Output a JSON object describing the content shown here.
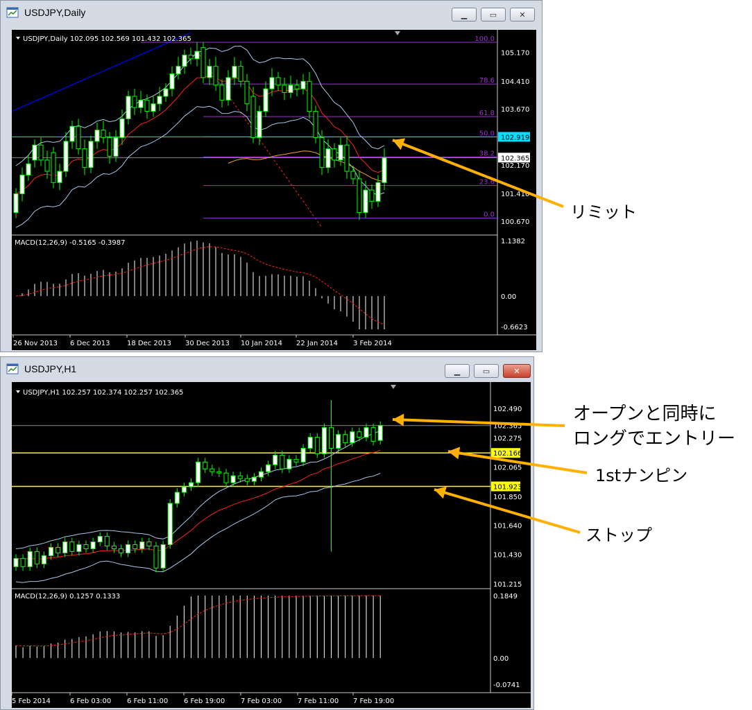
{
  "window_daily": {
    "title": "USDJPY,Daily",
    "header": "USDJPY,Daily  102.095 102.569 101.432 102.365",
    "price_labels": [
      "105.170",
      "104.410",
      "103.670",
      "102.919",
      "102.365",
      "102.170",
      "101.410",
      "100.670"
    ],
    "fib_labels": [
      "100.0",
      "78.6",
      "61.8",
      "50.0",
      "38.2",
      "23.6",
      "0.0"
    ],
    "macd_header": "MACD(12,26,9) -0.5165 -0.3987",
    "macd_labels": [
      "1.1382",
      "0.00",
      "-0.6623"
    ],
    "date_labels": [
      "26 Nov 2013",
      "6 Dec 2013",
      "18 Dec 2013",
      "30 Dec 2013",
      "10 Jan 2014",
      "22 Jan 2014",
      "3 Feb 2014"
    ]
  },
  "window_h1": {
    "title": "USDJPY,H1",
    "header": "USDJPY,H1  102.257 102.374 102.257 102.365",
    "price_labels": [
      "102.490",
      "102.365",
      "102.275",
      "102.166",
      "102.065",
      "101.923",
      "101.850",
      "101.640",
      "101.430",
      "101.215"
    ],
    "macd_header": "MACD(12,26,9) 0.1257 0.1333",
    "macd_labels": [
      "0.1849",
      "0.00",
      "-0.0741"
    ],
    "date_labels": [
      "5 Feb 2014",
      "6 Feb 03:00",
      "6 Feb 11:00",
      "6 Feb 19:00",
      "7 Feb 03:00",
      "7 Feb 11:00",
      "7 Feb 19:00"
    ]
  },
  "annotations": {
    "limit": "リミット",
    "open_entry_line1": "オープンと同時に",
    "open_entry_line2": "ロングでエントリー",
    "nanpin": "1stナンピン",
    "stop": "ストップ"
  },
  "colors": {
    "chart_bg": "#000000",
    "bull_candle": "#ffffff",
    "bear_candle": "#000000",
    "candle_wick": "#00ff00",
    "bollinger": "#a8c8e8",
    "ma_red": "#ff2020",
    "ma_orange": "#ffa020",
    "fib": "#9933cc",
    "trend_blue": "#0000ff",
    "level_cyan": "#00e0ff",
    "level_yellow": "#ffff00",
    "arrow": "#ffb000"
  },
  "chart_data": [
    {
      "type": "candlestick",
      "title": "USDJPY,Daily",
      "ylim": [
        100.3,
        105.7
      ],
      "fib_levels": {
        "100.0": 105.44,
        "78.6": 104.33,
        "61.8": 103.46,
        "50.0": 102.92,
        "38.2": 102.38,
        "23.6": 101.62,
        "0.0": 100.75
      },
      "limit_level": 102.919,
      "current_price": 102.365,
      "candles": [
        {
          "o": 100.9,
          "c": 101.4
        },
        {
          "o": 101.4,
          "c": 101.9
        },
        {
          "o": 101.9,
          "c": 102.2
        },
        {
          "o": 102.3,
          "c": 102.7
        },
        {
          "o": 102.7,
          "c": 102.3
        },
        {
          "o": 102.3,
          "c": 102.0
        },
        {
          "o": 102.5,
          "c": 101.7
        },
        {
          "o": 101.7,
          "c": 102.0
        },
        {
          "o": 102.0,
          "c": 102.8
        },
        {
          "o": 102.8,
          "c": 103.2
        },
        {
          "o": 103.2,
          "c": 102.6
        },
        {
          "o": 102.6,
          "c": 102.1
        },
        {
          "o": 102.1,
          "c": 102.8
        },
        {
          "o": 102.8,
          "c": 103.1
        },
        {
          "o": 103.1,
          "c": 102.9
        },
        {
          "o": 102.9,
          "c": 102.4
        },
        {
          "o": 102.4,
          "c": 102.9
        },
        {
          "o": 102.9,
          "c": 103.4
        },
        {
          "o": 103.4,
          "c": 104.0
        },
        {
          "o": 104.0,
          "c": 103.7
        },
        {
          "o": 103.7,
          "c": 103.9
        },
        {
          "o": 103.9,
          "c": 103.6
        },
        {
          "o": 103.6,
          "c": 103.8
        },
        {
          "o": 103.8,
          "c": 104.0
        },
        {
          "o": 104.0,
          "c": 104.2
        },
        {
          "o": 104.2,
          "c": 104.6
        },
        {
          "o": 104.6,
          "c": 104.8
        },
        {
          "o": 104.8,
          "c": 105.1
        },
        {
          "o": 105.1,
          "c": 105.0
        },
        {
          "o": 105.0,
          "c": 105.2
        },
        {
          "o": 105.3,
          "c": 104.5
        },
        {
          "o": 104.5,
          "c": 104.8
        },
        {
          "o": 104.8,
          "c": 104.3
        },
        {
          "o": 104.3,
          "c": 103.9
        },
        {
          "o": 103.9,
          "c": 104.5
        },
        {
          "o": 104.5,
          "c": 104.8
        },
        {
          "o": 104.8,
          "c": 104.4
        },
        {
          "o": 104.4,
          "c": 103.8
        },
        {
          "o": 104.0,
          "c": 102.9
        },
        {
          "o": 102.9,
          "c": 103.6
        },
        {
          "o": 103.6,
          "c": 104.2
        },
        {
          "o": 104.2,
          "c": 104.5
        },
        {
          "o": 104.5,
          "c": 104.3
        },
        {
          "o": 104.3,
          "c": 104.1
        },
        {
          "o": 104.1,
          "c": 104.3
        },
        {
          "o": 104.3,
          "c": 104.2
        },
        {
          "o": 104.2,
          "c": 104.4
        },
        {
          "o": 104.4,
          "c": 103.6
        },
        {
          "o": 103.6,
          "c": 102.9
        },
        {
          "o": 102.9,
          "c": 102.1
        },
        {
          "o": 102.1,
          "c": 102.6
        },
        {
          "o": 102.6,
          "c": 102.3
        },
        {
          "o": 102.3,
          "c": 102.7
        },
        {
          "o": 102.7,
          "c": 102.0
        },
        {
          "o": 102.0,
          "c": 101.8
        },
        {
          "o": 101.8,
          "c": 100.9
        },
        {
          "o": 100.9,
          "c": 101.5
        },
        {
          "o": 101.5,
          "c": 101.2
        },
        {
          "o": 101.2,
          "c": 101.7
        },
        {
          "o": 101.7,
          "c": 102.365
        }
      ]
    },
    {
      "type": "candlestick",
      "title": "USDJPY,H1",
      "ylim": [
        101.13,
        102.57
      ],
      "entry_level": 102.365,
      "nanpin_level": 102.166,
      "stop_level": 101.923,
      "candles": [
        {
          "o": 101.34,
          "c": 101.4
        },
        {
          "o": 101.4,
          "c": 101.34
        },
        {
          "o": 101.34,
          "c": 101.45
        },
        {
          "o": 101.45,
          "c": 101.36
        },
        {
          "o": 101.36,
          "c": 101.42
        },
        {
          "o": 101.42,
          "c": 101.48
        },
        {
          "o": 101.48,
          "c": 101.44
        },
        {
          "o": 101.44,
          "c": 101.52
        },
        {
          "o": 101.52,
          "c": 101.45
        },
        {
          "o": 101.45,
          "c": 101.5
        },
        {
          "o": 101.5,
          "c": 101.47
        },
        {
          "o": 101.47,
          "c": 101.52
        },
        {
          "o": 101.52,
          "c": 101.56
        },
        {
          "o": 101.56,
          "c": 101.49
        },
        {
          "o": 101.49,
          "c": 101.47
        },
        {
          "o": 101.47,
          "c": 101.44
        },
        {
          "o": 101.44,
          "c": 101.5
        },
        {
          "o": 101.5,
          "c": 101.47
        },
        {
          "o": 101.47,
          "c": 101.52
        },
        {
          "o": 101.52,
          "c": 101.49
        },
        {
          "o": 101.49,
          "c": 101.33
        },
        {
          "o": 101.33,
          "c": 101.5
        },
        {
          "o": 101.5,
          "c": 101.8
        },
        {
          "o": 101.8,
          "c": 101.88
        },
        {
          "o": 101.88,
          "c": 101.92
        },
        {
          "o": 101.92,
          "c": 101.95
        },
        {
          "o": 101.95,
          "c": 102.1
        },
        {
          "o": 102.1,
          "c": 102.05
        },
        {
          "o": 102.05,
          "c": 102.03
        },
        {
          "o": 102.03,
          "c": 102.02
        },
        {
          "o": 102.02,
          "c": 101.95
        },
        {
          "o": 101.95,
          "c": 102.0
        },
        {
          "o": 102.0,
          "c": 101.98
        },
        {
          "o": 101.98,
          "c": 101.96
        },
        {
          "o": 101.96,
          "c": 101.99
        },
        {
          "o": 101.99,
          "c": 102.03
        },
        {
          "o": 102.03,
          "c": 102.08
        },
        {
          "o": 102.08,
          "c": 102.15
        },
        {
          "o": 102.15,
          "c": 102.05
        },
        {
          "o": 102.05,
          "c": 102.12
        },
        {
          "o": 102.12,
          "c": 102.1
        },
        {
          "o": 102.1,
          "c": 102.2
        },
        {
          "o": 102.2,
          "c": 102.28
        },
        {
          "o": 102.28,
          "c": 102.16
        },
        {
          "o": 102.16,
          "c": 102.35
        },
        {
          "o": 102.35,
          "c": 102.2
        },
        {
          "o": 102.2,
          "c": 102.3
        },
        {
          "o": 102.3,
          "c": 102.24
        },
        {
          "o": 102.24,
          "c": 102.32
        },
        {
          "o": 102.32,
          "c": 102.28
        },
        {
          "o": 102.28,
          "c": 102.35
        },
        {
          "o": 102.35,
          "c": 102.25
        },
        {
          "o": 102.257,
          "c": 102.365
        }
      ]
    }
  ]
}
